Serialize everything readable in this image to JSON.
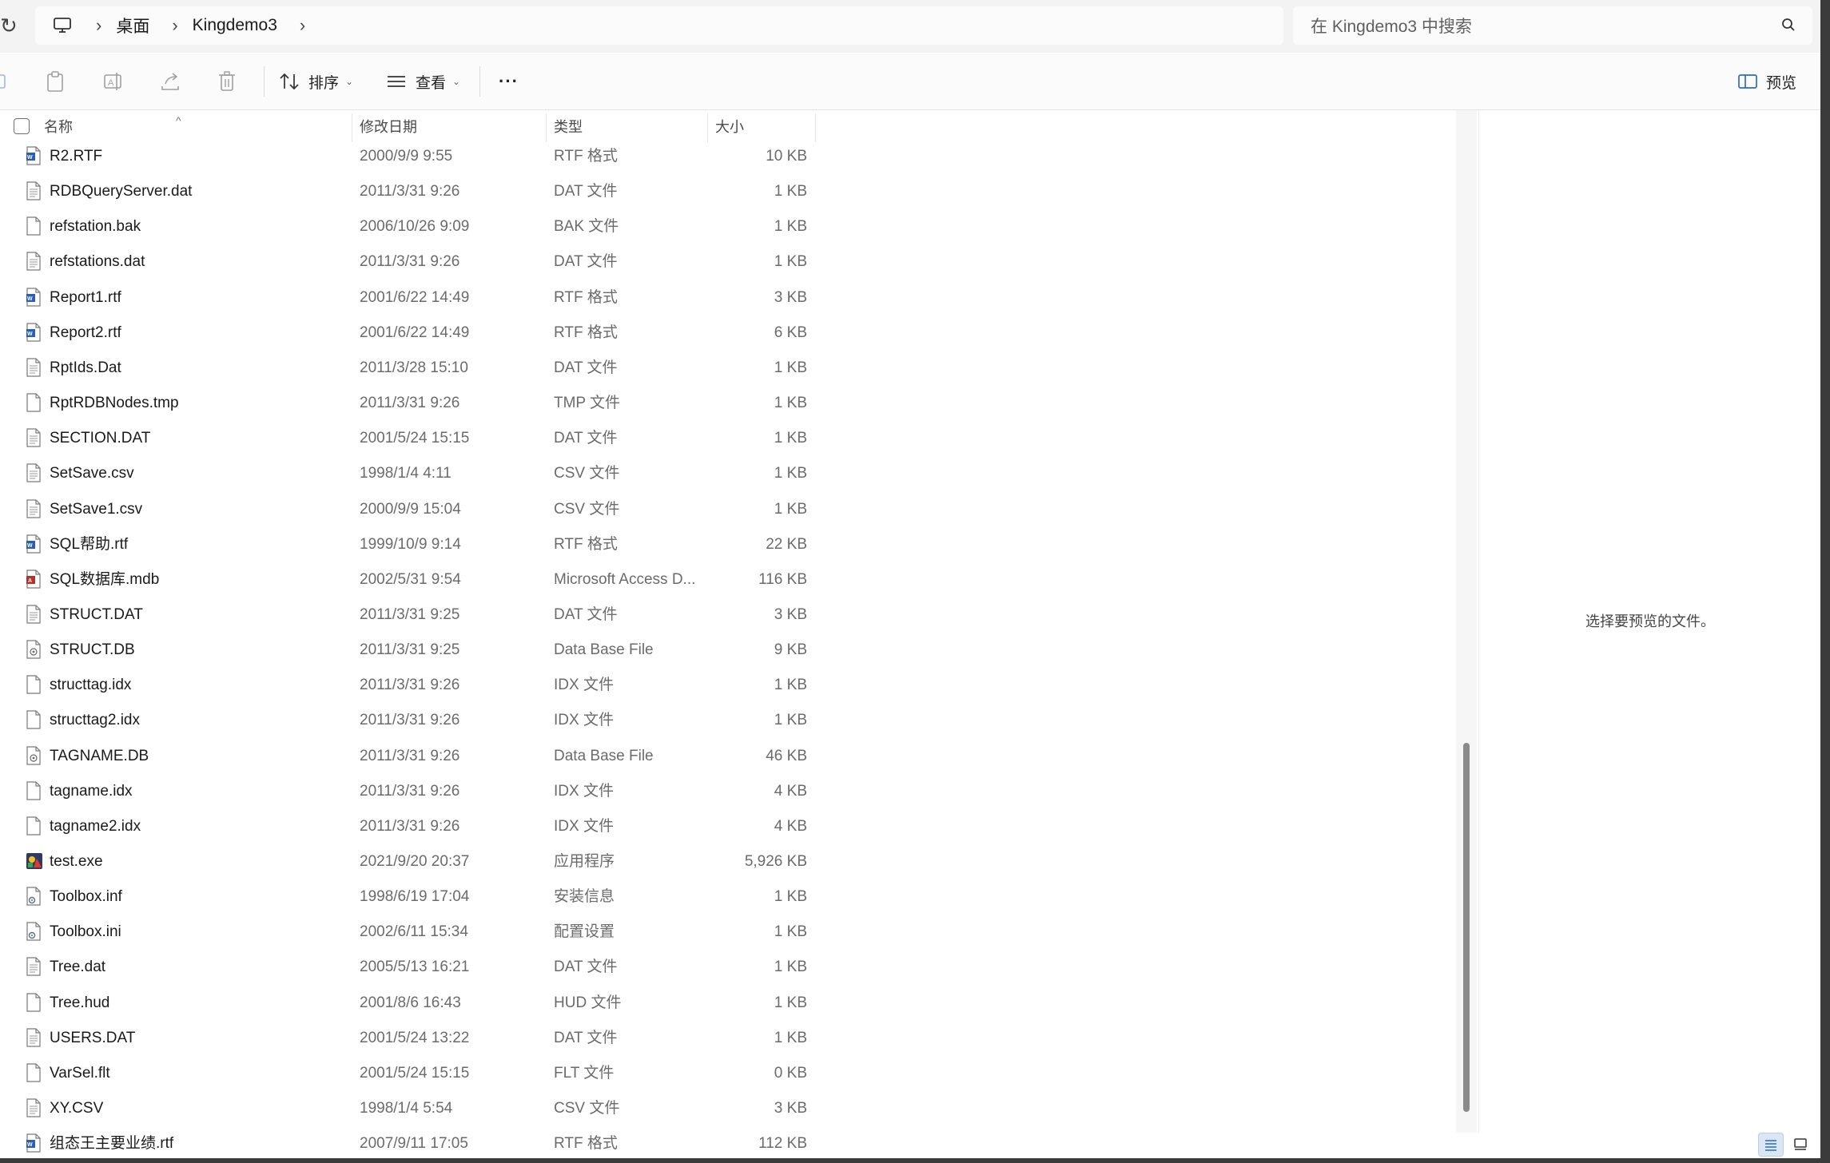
{
  "address": {
    "crumbs": [
      "桌面",
      "Kingdemo3"
    ]
  },
  "search": {
    "placeholder": "在 Kingdemo3 中搜索"
  },
  "toolbar": {
    "sort_label": "排序",
    "view_label": "查看",
    "more_label": "···",
    "preview_label": "预览"
  },
  "columns": {
    "name": "名称",
    "date": "修改日期",
    "type": "类型",
    "size": "大小"
  },
  "files": [
    {
      "name": "R2.RTF",
      "date": "2000/9/9 9:55",
      "type": "RTF 格式",
      "size": "10 KB",
      "icon": "rtf-doc-icon"
    },
    {
      "name": "RDBQueryServer.dat",
      "date": "2011/3/31 9:26",
      "type": "DAT 文件",
      "size": "1 KB",
      "icon": "text-file-icon"
    },
    {
      "name": "refstation.bak",
      "date": "2006/10/26 9:09",
      "type": "BAK 文件",
      "size": "1 KB",
      "icon": "blank-file-icon"
    },
    {
      "name": "refstations.dat",
      "date": "2011/3/31 9:26",
      "type": "DAT 文件",
      "size": "1 KB",
      "icon": "text-file-icon"
    },
    {
      "name": "Report1.rtf",
      "date": "2001/6/22 14:49",
      "type": "RTF 格式",
      "size": "3 KB",
      "icon": "rtf-doc-icon"
    },
    {
      "name": "Report2.rtf",
      "date": "2001/6/22 14:49",
      "type": "RTF 格式",
      "size": "6 KB",
      "icon": "rtf-doc-icon"
    },
    {
      "name": "RptIds.Dat",
      "date": "2011/3/28 15:10",
      "type": "DAT 文件",
      "size": "1 KB",
      "icon": "text-file-icon"
    },
    {
      "name": "RptRDBNodes.tmp",
      "date": "2011/3/31 9:26",
      "type": "TMP 文件",
      "size": "1 KB",
      "icon": "blank-file-icon"
    },
    {
      "name": "SECTION.DAT",
      "date": "2001/5/24 15:15",
      "type": "DAT 文件",
      "size": "1 KB",
      "icon": "text-file-icon"
    },
    {
      "name": "SetSave.csv",
      "date": "1998/1/4 4:11",
      "type": "CSV 文件",
      "size": "1 KB",
      "icon": "text-file-icon"
    },
    {
      "name": "SetSave1.csv",
      "date": "2000/9/9 15:04",
      "type": "CSV 文件",
      "size": "1 KB",
      "icon": "text-file-icon"
    },
    {
      "name": "SQL帮助.rtf",
      "date": "1999/10/9 9:14",
      "type": "RTF 格式",
      "size": "22 KB",
      "icon": "rtf-doc-icon"
    },
    {
      "name": "SQL数据库.mdb",
      "date": "2002/5/31 9:54",
      "type": "Microsoft Access D...",
      "size": "116 KB",
      "icon": "access-db-icon"
    },
    {
      "name": "STRUCT.DAT",
      "date": "2011/3/31 9:25",
      "type": "DAT 文件",
      "size": "3 KB",
      "icon": "text-file-icon"
    },
    {
      "name": "STRUCT.DB",
      "date": "2011/3/31 9:25",
      "type": "Data Base File",
      "size": "9 KB",
      "icon": "db-file-icon"
    },
    {
      "name": "structtag.idx",
      "date": "2011/3/31 9:26",
      "type": "IDX 文件",
      "size": "1 KB",
      "icon": "blank-file-icon"
    },
    {
      "name": "structtag2.idx",
      "date": "2011/3/31 9:26",
      "type": "IDX 文件",
      "size": "1 KB",
      "icon": "blank-file-icon"
    },
    {
      "name": "TAGNAME.DB",
      "date": "2011/3/31 9:26",
      "type": "Data Base File",
      "size": "46 KB",
      "icon": "db-file-icon"
    },
    {
      "name": "tagname.idx",
      "date": "2011/3/31 9:26",
      "type": "IDX 文件",
      "size": "4 KB",
      "icon": "blank-file-icon"
    },
    {
      "name": "tagname2.idx",
      "date": "2011/3/31 9:26",
      "type": "IDX 文件",
      "size": "4 KB",
      "icon": "blank-file-icon"
    },
    {
      "name": "test.exe",
      "date": "2021/9/20 20:37",
      "type": "应用程序",
      "size": "5,926 KB",
      "icon": "exe-app-icon"
    },
    {
      "name": "Toolbox.inf",
      "date": "1998/6/19 17:04",
      "type": "安装信息",
      "size": "1 KB",
      "icon": "settings-file-icon"
    },
    {
      "name": "Toolbox.ini",
      "date": "2002/6/11 15:34",
      "type": "配置设置",
      "size": "1 KB",
      "icon": "settings-file-icon"
    },
    {
      "name": "Tree.dat",
      "date": "2005/5/13 16:21",
      "type": "DAT 文件",
      "size": "1 KB",
      "icon": "text-file-icon"
    },
    {
      "name": "Tree.hud",
      "date": "2001/8/6 16:43",
      "type": "HUD 文件",
      "size": "1 KB",
      "icon": "blank-file-icon"
    },
    {
      "name": "USERS.DAT",
      "date": "2001/5/24 13:22",
      "type": "DAT 文件",
      "size": "1 KB",
      "icon": "text-file-icon"
    },
    {
      "name": "VarSel.flt",
      "date": "2001/5/24 15:15",
      "type": "FLT 文件",
      "size": "0 KB",
      "icon": "blank-file-icon"
    },
    {
      "name": "XY.CSV",
      "date": "1998/1/4 5:54",
      "type": "CSV 文件",
      "size": "3 KB",
      "icon": "text-file-icon"
    },
    {
      "name": "组态王主要业绩.rtf",
      "date": "2007/9/11 17:05",
      "type": "RTF 格式",
      "size": "112 KB",
      "icon": "rtf-doc-icon"
    }
  ],
  "preview_pane": {
    "message": "选择要预览的文件。"
  }
}
